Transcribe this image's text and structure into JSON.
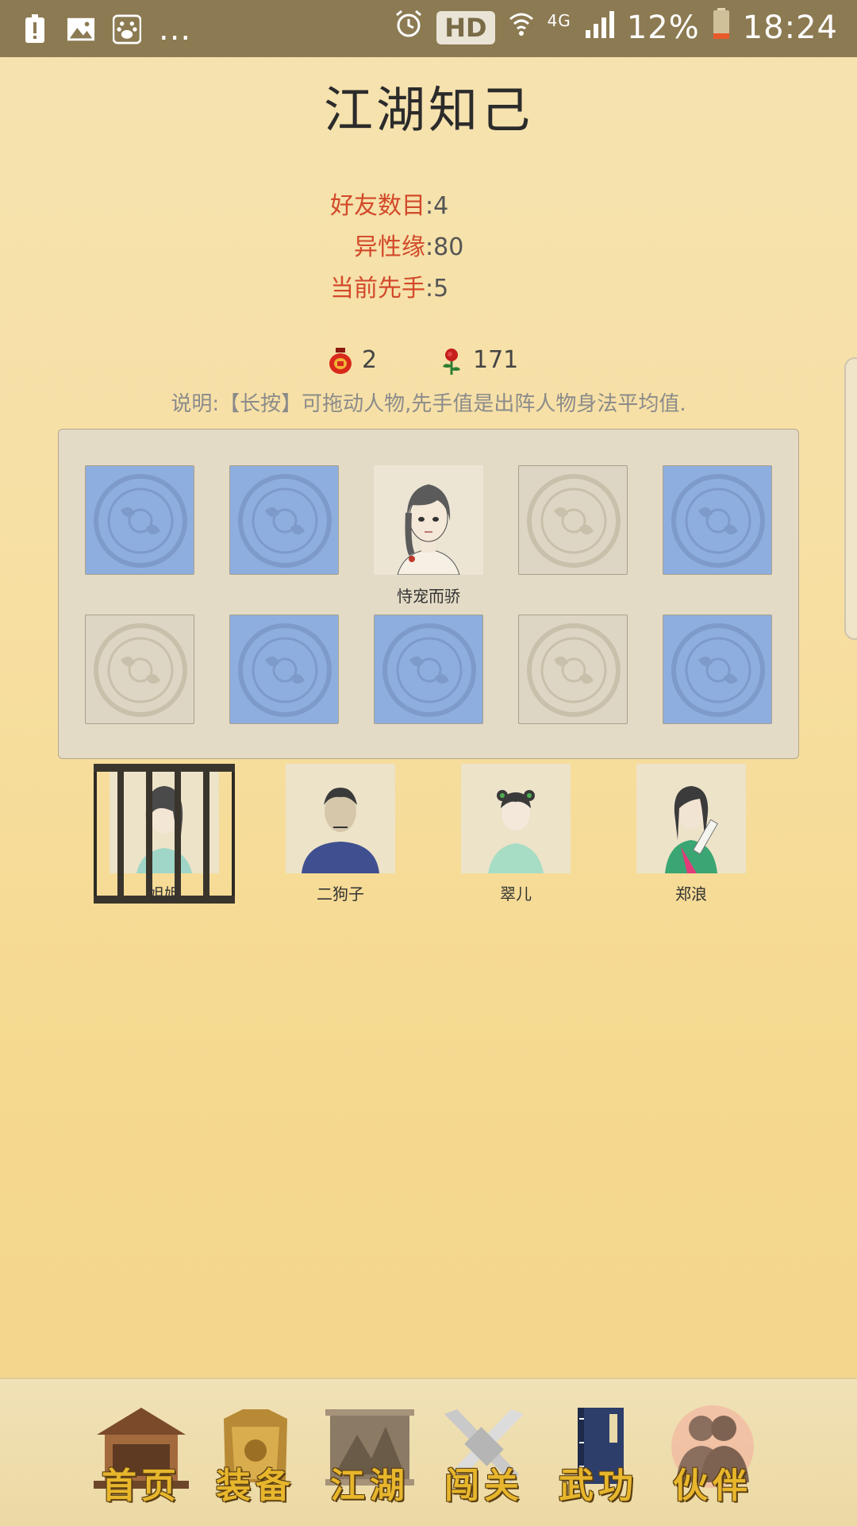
{
  "status_bar": {
    "more": "...",
    "hd": "HD",
    "network": "4G",
    "battery": "12%",
    "time": "18:24"
  },
  "page": {
    "title": "江湖知己"
  },
  "stats": [
    {
      "label": "好友数目",
      "value": ":4"
    },
    {
      "label": "异性缘",
      "value": ":80"
    },
    {
      "label": "当前先手",
      "value": ":5"
    }
  ],
  "resources": {
    "pot_count": "2",
    "rose_count": "171"
  },
  "description": "说明:【长按】可拖动人物,先手值是出阵人物身法平均值.",
  "formation": {
    "row1": [
      "blue",
      "blue",
      "filled",
      "beige",
      "blue"
    ],
    "row2": [
      "beige",
      "blue",
      "blue",
      "beige",
      "blue"
    ],
    "filled_label": "恃宠而骄"
  },
  "characters": [
    {
      "name": "姐姐",
      "locked": true
    },
    {
      "name": "二狗子",
      "locked": false
    },
    {
      "name": "翠儿",
      "locked": false
    },
    {
      "name": "郑浪",
      "locked": false
    }
  ],
  "nav": [
    {
      "label": "首页",
      "icon": "house-icon"
    },
    {
      "label": "装备",
      "icon": "armor-icon"
    },
    {
      "label": "江湖",
      "icon": "scroll-map-icon"
    },
    {
      "label": "闯关",
      "icon": "crossed-swords-icon"
    },
    {
      "label": "武功",
      "icon": "book-icon"
    },
    {
      "label": "伙伴",
      "icon": "partners-icon",
      "active": true
    }
  ],
  "colors": {
    "accent_label": "#d2492a",
    "slot_blue": "#8eaee0",
    "nav_gold": "#e7b62c"
  }
}
